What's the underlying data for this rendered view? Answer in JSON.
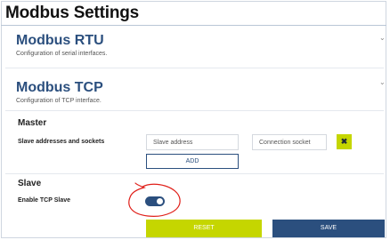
{
  "page": {
    "title": "Modbus Settings"
  },
  "rtu": {
    "title": "Modbus RTU",
    "subtitle": "Configuration of serial interfaces."
  },
  "tcp": {
    "title": "Modbus TCP",
    "subtitle": "Configuration of TCP interface."
  },
  "master": {
    "heading": "Master",
    "slave_label": "Slave addresses and sockets",
    "slave_address_placeholder": "Slave address",
    "connection_socket_placeholder": "Connection socket",
    "remove_label": "✖",
    "add_label": "ADD"
  },
  "slave": {
    "heading": "Slave",
    "enable_label": "Enable TCP Slave",
    "enabled": true
  },
  "actions": {
    "reset_label": "RESET",
    "save_label": "SAVE"
  },
  "icons": {
    "expand": "chevron-down-icon",
    "remove": "close-icon"
  },
  "colors": {
    "accent": "#c5d600",
    "primary": "#2b4f7e",
    "annotation": "#e0201a"
  }
}
